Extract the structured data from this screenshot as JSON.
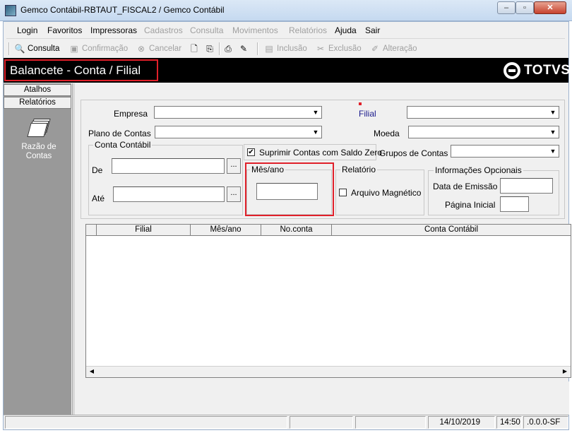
{
  "window": {
    "title": "Gemco Contábil-RBTAUT_FISCAL2 / Gemco Contábil",
    "min_label": "–",
    "max_label": "▫",
    "close_label": "✕"
  },
  "menu": {
    "items": [
      {
        "label": "Login"
      },
      {
        "label": "Favoritos"
      },
      {
        "label": "Impressoras"
      },
      {
        "label": "Cadastros"
      },
      {
        "label": "Consulta"
      },
      {
        "label": "Movimentos"
      },
      {
        "label": "Relatórios"
      },
      {
        "label": "Ajuda"
      },
      {
        "label": "Sair"
      }
    ]
  },
  "toolbar": {
    "consulta": "Consulta",
    "confirmacao": "Confirmação",
    "cancelar": "Cancelar",
    "inclusao": "Inclusão",
    "exclusao": "Exclusão",
    "alteracao": "Alteração"
  },
  "header": {
    "title": "Balancete - Conta / Filial",
    "brand": "TOTVS"
  },
  "sidebar": {
    "tabs": [
      "Atalhos",
      "Relatórios"
    ],
    "shortcut_label_line1": "Razão de",
    "shortcut_label_line2": "Contas"
  },
  "form": {
    "empresa_label": "Empresa",
    "empresa_value": "",
    "filial_label": "Filial",
    "filial_value": "",
    "plano_label": "Plano de Contas",
    "plano_value": "",
    "moeda_label": "Moeda",
    "moeda_value": "",
    "conta_group_title": "Conta Contábil",
    "de_label": "De",
    "de_value": "",
    "ate_label": "Até",
    "ate_value": "",
    "browse_label": "...",
    "suprimir_label": "Suprimir Contas com Saldo Zero",
    "suprimir_checked": true,
    "grupos_label": "Grupos de Contas",
    "grupos_value": "",
    "mesano_group_title": "Mês/ano",
    "mesano_value": "",
    "relatorio_group_title": "Relatório",
    "arquivo_label": "Arquivo Magnético",
    "arquivo_checked": false,
    "info_group_title": "Informações Opcionais",
    "data_emissao_label": "Data de Emissão",
    "data_emissao_value": "",
    "pagina_inicial_label": "Página Inicial",
    "pagina_inicial_value": ""
  },
  "grid": {
    "columns": [
      "",
      "Filial",
      "Mês/ano",
      "No.conta",
      "Conta Contábil"
    ],
    "rows": []
  },
  "statusbar": {
    "date": "14/10/2019",
    "time": "14:50",
    "version": ".0.0.0-SF"
  },
  "colors": {
    "highlight": "#e0202a",
    "banner": "#000000",
    "sidebar": "#999999"
  }
}
